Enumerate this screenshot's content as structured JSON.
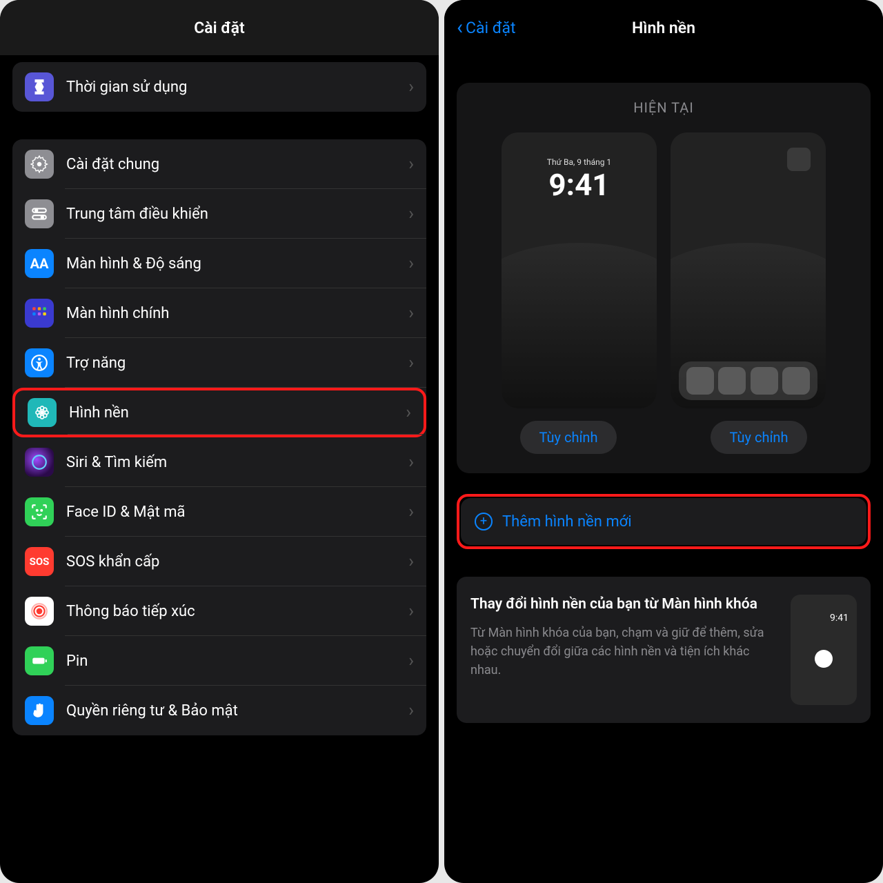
{
  "left": {
    "title": "Cài đặt",
    "screentime": {
      "label": "Thời gian sử dụng",
      "color": "#5856d6"
    },
    "items": [
      {
        "label": "Cài đặt chung",
        "color": "#8e8e93",
        "icon": "gear"
      },
      {
        "label": "Trung tâm điều khiển",
        "color": "#8e8e93",
        "icon": "toggles"
      },
      {
        "label": "Màn hình & Độ sáng",
        "color": "#0a84ff",
        "icon": "textsize"
      },
      {
        "label": "Màn hình chính",
        "color": "#2f2fbf",
        "icon": "grid"
      },
      {
        "label": "Trợ năng",
        "color": "#0a84ff",
        "icon": "accessibility"
      },
      {
        "label": "Hình nền",
        "color": "#20b8b8",
        "icon": "flower"
      },
      {
        "label": "Siri & Tìm kiếm",
        "color": "#1c1c1e",
        "icon": "siri"
      },
      {
        "label": "Face ID & Mật mã",
        "color": "#30d158",
        "icon": "faceid"
      },
      {
        "label": "SOS khẩn cấp",
        "color": "#ff3b30",
        "icon": "sos"
      },
      {
        "label": "Thông báo tiếp xúc",
        "color": "#ffffff",
        "icon": "exposure"
      },
      {
        "label": "Pin",
        "color": "#30d158",
        "icon": "battery"
      },
      {
        "label": "Quyền riêng tư & Bảo mật",
        "color": "#0a84ff",
        "icon": "hand"
      }
    ],
    "highlight_index": 5
  },
  "right": {
    "back": "Cài đặt",
    "title": "Hình nền",
    "current_label": "HIỆN TẠI",
    "lockscreen": {
      "date": "Thứ Ba, 9 tháng 1",
      "time": "9:41"
    },
    "customize_label": "Tùy chỉnh",
    "add_label": "Thêm hình nền mới",
    "tip": {
      "title": "Thay đổi hình nền của bạn từ Màn hình khóa",
      "desc": "Từ Màn hình khóa của bạn, chạm và giữ để thêm, sửa hoặc chuyển đổi giữa các hình nền và tiện ích khác nhau.",
      "thumb_time": "9:41"
    }
  }
}
